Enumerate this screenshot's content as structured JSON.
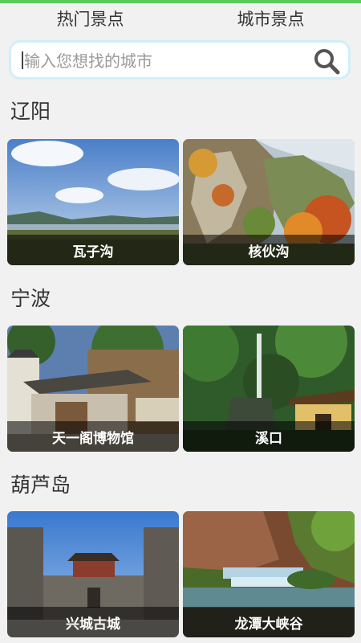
{
  "tabs": [
    {
      "label": "热门景点"
    },
    {
      "label": "城市景点"
    }
  ],
  "search": {
    "placeholder": "输入您想找的城市",
    "icon": "search-icon"
  },
  "colors": {
    "accent": "#5cc95c",
    "search_border": "#cfeff9"
  },
  "sections": [
    {
      "title": "辽阳",
      "items": [
        {
          "label": "瓦子沟"
        },
        {
          "label": "核伙沟"
        }
      ]
    },
    {
      "title": "宁波",
      "items": [
        {
          "label": "天一阁博物馆"
        },
        {
          "label": "溪口"
        }
      ]
    },
    {
      "title": "葫芦岛",
      "items": [
        {
          "label": "兴城古城"
        },
        {
          "label": "龙潭大峡谷"
        }
      ]
    }
  ]
}
